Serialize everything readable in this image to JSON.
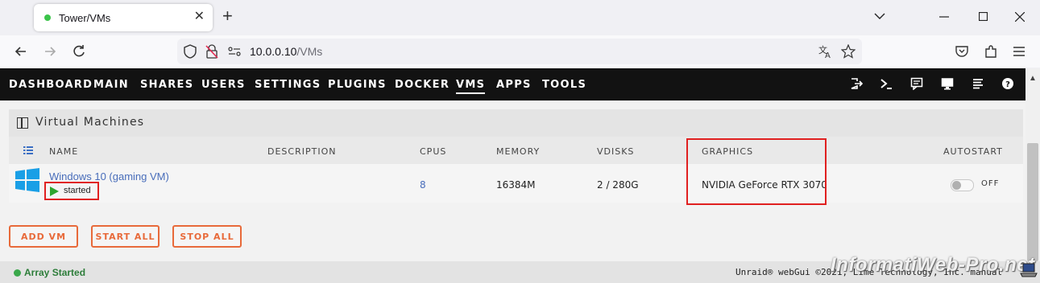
{
  "browser": {
    "tab_title": "Tower/VMs",
    "new_tab": "+",
    "url_host": "10.0.0.10",
    "url_path": "/VMs"
  },
  "menu": {
    "items": [
      "DASHBOARD",
      "MAIN",
      "SHARES",
      "USERS",
      "SETTINGS",
      "PLUGINS",
      "DOCKER",
      "VMS",
      "APPS",
      "TOOLS"
    ],
    "active": "VMS"
  },
  "section": {
    "title": "Virtual Machines"
  },
  "table": {
    "columns": [
      "NAME",
      "DESCRIPTION",
      "CPUS",
      "MEMORY",
      "VDISKS",
      "GRAPHICS",
      "AUTOSTART"
    ],
    "rows": [
      {
        "name": "Windows 10 (gaming VM)",
        "status": "started",
        "description": "",
        "cpus": "8",
        "memory": "16384M",
        "vdisks": "2 / 280G",
        "graphics": "NVIDIA GeForce RTX 3070",
        "autostart": "OFF"
      }
    ]
  },
  "buttons": {
    "add_vm": "ADD VM",
    "start_all": "START ALL",
    "stop_all": "STOP ALL"
  },
  "footer": {
    "status": "Array Started",
    "copyright": "Unraid® webGui ©2021, Lime Technology, Inc. manual"
  },
  "watermark": "InformatiWeb-Pro.net",
  "colors": {
    "accent": "#e86a3a",
    "highlight_box": "#e02020",
    "link": "#486dba",
    "status_green": "#2fa52f"
  }
}
